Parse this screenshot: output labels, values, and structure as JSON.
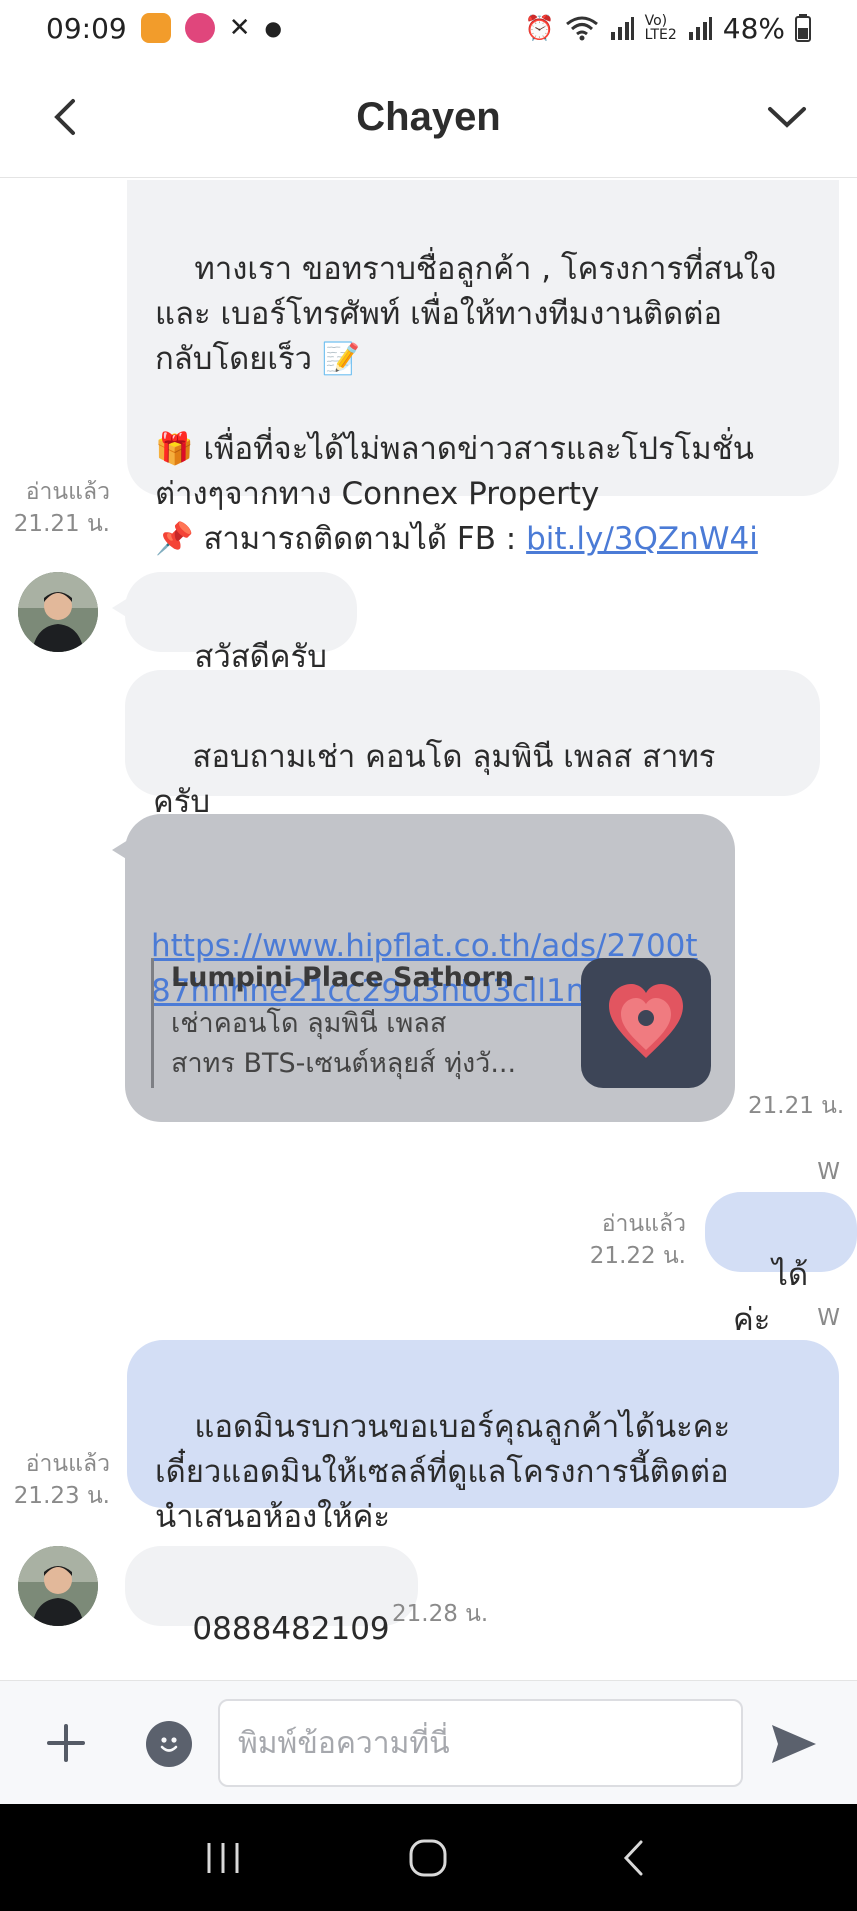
{
  "status_bar": {
    "time": "09:09",
    "battery": "48%"
  },
  "header": {
    "title": "Chayen"
  },
  "messages": [
    {
      "id": "m1",
      "text": "ทางเรา ขอทราบชื่อลูกค้า , โครงการที่สนใจ\nและ เบอร์โทรศัพท์ เพื่อให้ทางทีมงานติดต่อ\nกลับโดยเร็ว 📝\n\n🎁 เพื่อที่จะได้ไม่พลาดข่าวสารและโปรโมชั่น\nต่างๆจากทาง Connex Property\n📌 สามารถติดตามได้ FB : ",
      "link": "bit.ly/3QZnW4i",
      "read": "อ่านแล้ว",
      "time": "21.21 น."
    },
    {
      "id": "m2",
      "text": "สวัสดีครับ"
    },
    {
      "id": "m3",
      "text": "สอบถามเช่า คอนโด ลุมพินี เพลส สาทร\nครับ"
    },
    {
      "id": "m4",
      "link": "https://www.hipflat.co.th/ads/2700t87hnhne21cc29u3nt03cll1nue4",
      "preview_title": "Lumpini Place Sathorn - ...",
      "preview_desc": "เช่าคอนโด ลุมพินี เพลส\nสาทร BTS-เซนต์หลุยส์ ทุ่งวั...",
      "time": "21.21 น."
    },
    {
      "id": "m5",
      "sender_label": "W",
      "text": "ได้ค่ะ",
      "read": "อ่านแล้ว",
      "time": "21.22 น."
    },
    {
      "id": "m6",
      "sender_label": "W",
      "text": "แอดมินรบกวนขอเบอร์คุณลูกค้าได้นะคะ\nเดี๋ยวแอดมินให้เซลล์ที่ดูแลโครงการนี้ติดต่อ\nนำเสนอห้องให้ค่ะ",
      "read": "อ่านแล้ว",
      "time": "21.23 น."
    },
    {
      "id": "m7",
      "text": "0888482109",
      "time": "21.28 น."
    }
  ],
  "input": {
    "placeholder": "พิมพ์ข้อความที่นี่"
  },
  "colors": {
    "incoming_bubble": "#f1f2f4",
    "outgoing_bubble": "#d3def5",
    "link_preview_bubble": "#c2c4c9",
    "link": "#4b7bd6"
  }
}
